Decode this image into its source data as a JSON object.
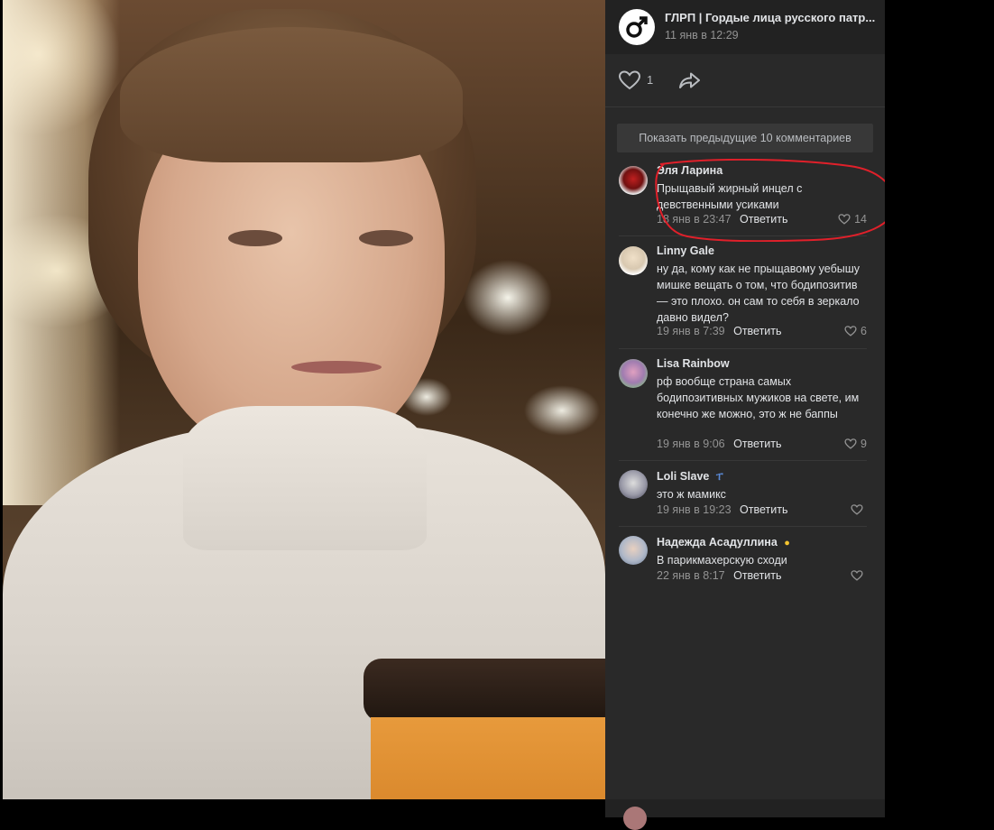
{
  "post": {
    "group_name": "ГЛРП | Гордые лица русского патр...",
    "date": "11 янв в 12:29",
    "likes": "1"
  },
  "comments_section": {
    "show_previous_label": "Показать предыдущие 10 комментариев",
    "reply_label": "Ответить",
    "items": [
      {
        "author": "Эля Ларина",
        "text": "Прыщавый жирный инцел с девственными усиками",
        "date": "18 янв в 23:47",
        "likes": "14",
        "avatar_color": "#b02020"
      },
      {
        "author": "Linny Gale",
        "text": "ну да, кому как не прыщавому уебышу мишке вещать о том, что бодипозитив — это плохо. он сам то себя в зеркало давно видел?",
        "date": "19 янв в 7:39",
        "likes": "6",
        "avatar_color": "#d8c8b0"
      },
      {
        "author": "Lisa Rainbow",
        "text": "рф вообще страна самых бодипозитивных мужиков на свете, им конечно же можно, это ж не баппы",
        "date": "19 янв в 9:06",
        "likes": "9",
        "avatar_color": "#c89ab0"
      },
      {
        "author": "Loli Slave",
        "text": "это ж мамикс",
        "date": "19 янв в 19:23",
        "likes": "",
        "avatar_color": "#9a9aa8"
      },
      {
        "author": "Надежда Асадуллина",
        "text": "В парикмахерскую сходи",
        "date": "22 янв в 8:17",
        "likes": "",
        "avatar_color": "#b0b8c8"
      }
    ]
  },
  "colors": {
    "sidebar_bg": "#292929",
    "header_bg": "#222222",
    "text_primary": "#e1e3e6",
    "text_secondary": "#939393",
    "highlight_stroke": "#e0202a"
  },
  "icons": {
    "group_logo": "male-symbol-icon",
    "like": "heart-outline-icon",
    "share": "share-arrow-icon"
  }
}
